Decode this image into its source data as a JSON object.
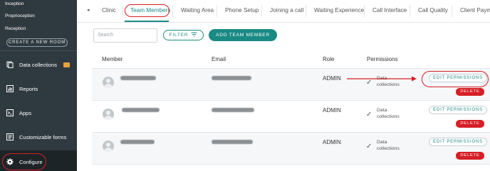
{
  "sidebar": {
    "rooms": [
      "Inception",
      "Proprioception",
      "Reception"
    ],
    "create_room_label": "CREATE A NEW ROOM",
    "nav": [
      {
        "label": "Data collections",
        "icon": "data-collections-icon",
        "badge": ""
      },
      {
        "label": "Reports",
        "icon": "reports-icon"
      },
      {
        "label": "Apps",
        "icon": "apps-icon"
      },
      {
        "label": "Customizable forms",
        "icon": "forms-icon"
      },
      {
        "label": "Configure",
        "icon": "gear-icon"
      }
    ]
  },
  "tabs": [
    "Clinic",
    "Team Members",
    "Waiting Area",
    "Phone Setup",
    "Joining a call",
    "Waiting Experience",
    "Call Interface",
    "Call Quality",
    "Client Payme"
  ],
  "active_tab": "Team Members",
  "toolbar": {
    "search_placeholder": "Search",
    "filter_label": "FILTER",
    "add_member_label": "ADD TEAM MEMBER"
  },
  "table": {
    "columns": [
      "Member",
      "Email",
      "Role",
      "Permissions"
    ],
    "rows": [
      {
        "role": "ADMIN",
        "permissions": [
          "Data",
          "collections"
        ],
        "edit_label": "EDIT PERMISSIONS",
        "delete_label": "DELETE"
      },
      {
        "role": "ADMIN",
        "permissions": [
          "Data",
          "collections"
        ],
        "edit_label": "EDIT PERMISSIONS",
        "delete_label": "DELETE"
      },
      {
        "role": "ADMIN",
        "permissions": [
          "Data",
          "collections"
        ],
        "edit_label": "EDIT PERMISSIONS",
        "delete_label": "DELETE"
      }
    ]
  },
  "colors": {
    "accent": "#1a8a84",
    "sidebar": "#2f3a40",
    "danger": "#d61f26",
    "highlight": "#d61f26"
  }
}
